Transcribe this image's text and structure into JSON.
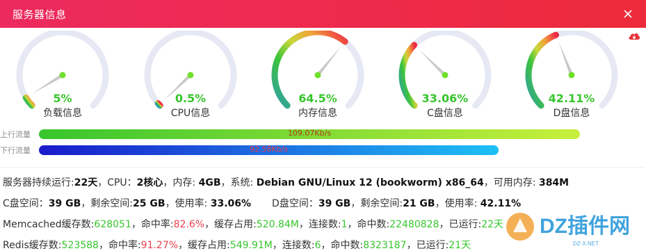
{
  "window": {
    "title": "服务器信息",
    "close_icon": "close-icon",
    "export_icon": "cloud-download-icon"
  },
  "gauges": [
    {
      "key": "load",
      "label": "负载信息",
      "value_text": "5%",
      "percent": 5
    },
    {
      "key": "cpu",
      "label": "CPU信息",
      "value_text": "0.5%",
      "percent": 0.5
    },
    {
      "key": "memory",
      "label": "内存信息",
      "value_text": "64.5%",
      "percent": 64.5
    },
    {
      "key": "disk_c",
      "label": "C盘信息",
      "value_text": "33.06%",
      "percent": 33.06
    },
    {
      "key": "disk_d",
      "label": "D盘信息",
      "value_text": "42.11%",
      "percent": 42.11
    }
  ],
  "traffic": {
    "upload": {
      "label": "上行流量",
      "value": "109.07Kb/s",
      "fill": 1.0
    },
    "download": {
      "label": "下行流量",
      "value": "92.58Kb/s",
      "fill": 1.0
    }
  },
  "info": {
    "uptime_label": "服务器持续运行:",
    "uptime_value": "22天",
    "cpu_label": "，CPU：",
    "cpu_value": "2核心",
    "mem_label": "，内存: ",
    "mem_value": "4GB",
    "os_label": "，系统: ",
    "os_value": "Debian GNU/Linux 12 (bookworm) x86_64",
    "avail_label": "，可用内存: ",
    "avail_value": "384M",
    "c_space_label": "C盘空间：",
    "c_space_value": "39 GB",
    "c_free_label": "，剩余空间:",
    "c_free_value": "25 GB",
    "c_usage_label": "，使用率: ",
    "c_usage_value": "33.06%",
    "d_space_label": "D盘空间：",
    "d_space_value": "39 GB",
    "d_free_label": "，剩余空间:",
    "d_free_value": "21 GB",
    "d_usage_label": "，使用率: ",
    "d_usage_value": "42.11%",
    "mc_label": "Memcached缓存数:",
    "mc_count": "628051",
    "mc_hit_label": "，命中率:",
    "mc_hit": "82.6%",
    "mc_mem_label": "，缓存占用:",
    "mc_mem": "520.84M",
    "mc_conn_label": "，连接数:",
    "mc_conn": "1",
    "mc_hits_label": "，命中数:",
    "mc_hits": "22480828",
    "mc_run_label": "，已运行:",
    "mc_run": "22天",
    "rd_label": "Redis缓存数:",
    "rd_count": "523588",
    "rd_hit_label": "，命中率:",
    "rd_hit": "91.27%",
    "rd_mem_label": "，缓存占用:",
    "rd_mem": "549.91M",
    "rd_conn_label": "，连接数:",
    "rd_conn": "6",
    "rd_hits_label": "，命中数:",
    "rd_hits": "8323187",
    "rd_run_label": "，已运行:",
    "rd_run": "21天"
  },
  "watermark": {
    "text": "DZ插件网",
    "subtext": "DZ-X.NET"
  },
  "colors": {
    "title_bar": "#ec2a4a",
    "value_green": "#37c52d",
    "highlight_red": "#e8404e",
    "track": "#e6e9f4",
    "upload_bar_start": "#37c52d",
    "upload_bar_end": "#c8f03c",
    "download_bar_start": "#1a1acb",
    "download_bar_end": "#1ec0f5"
  }
}
